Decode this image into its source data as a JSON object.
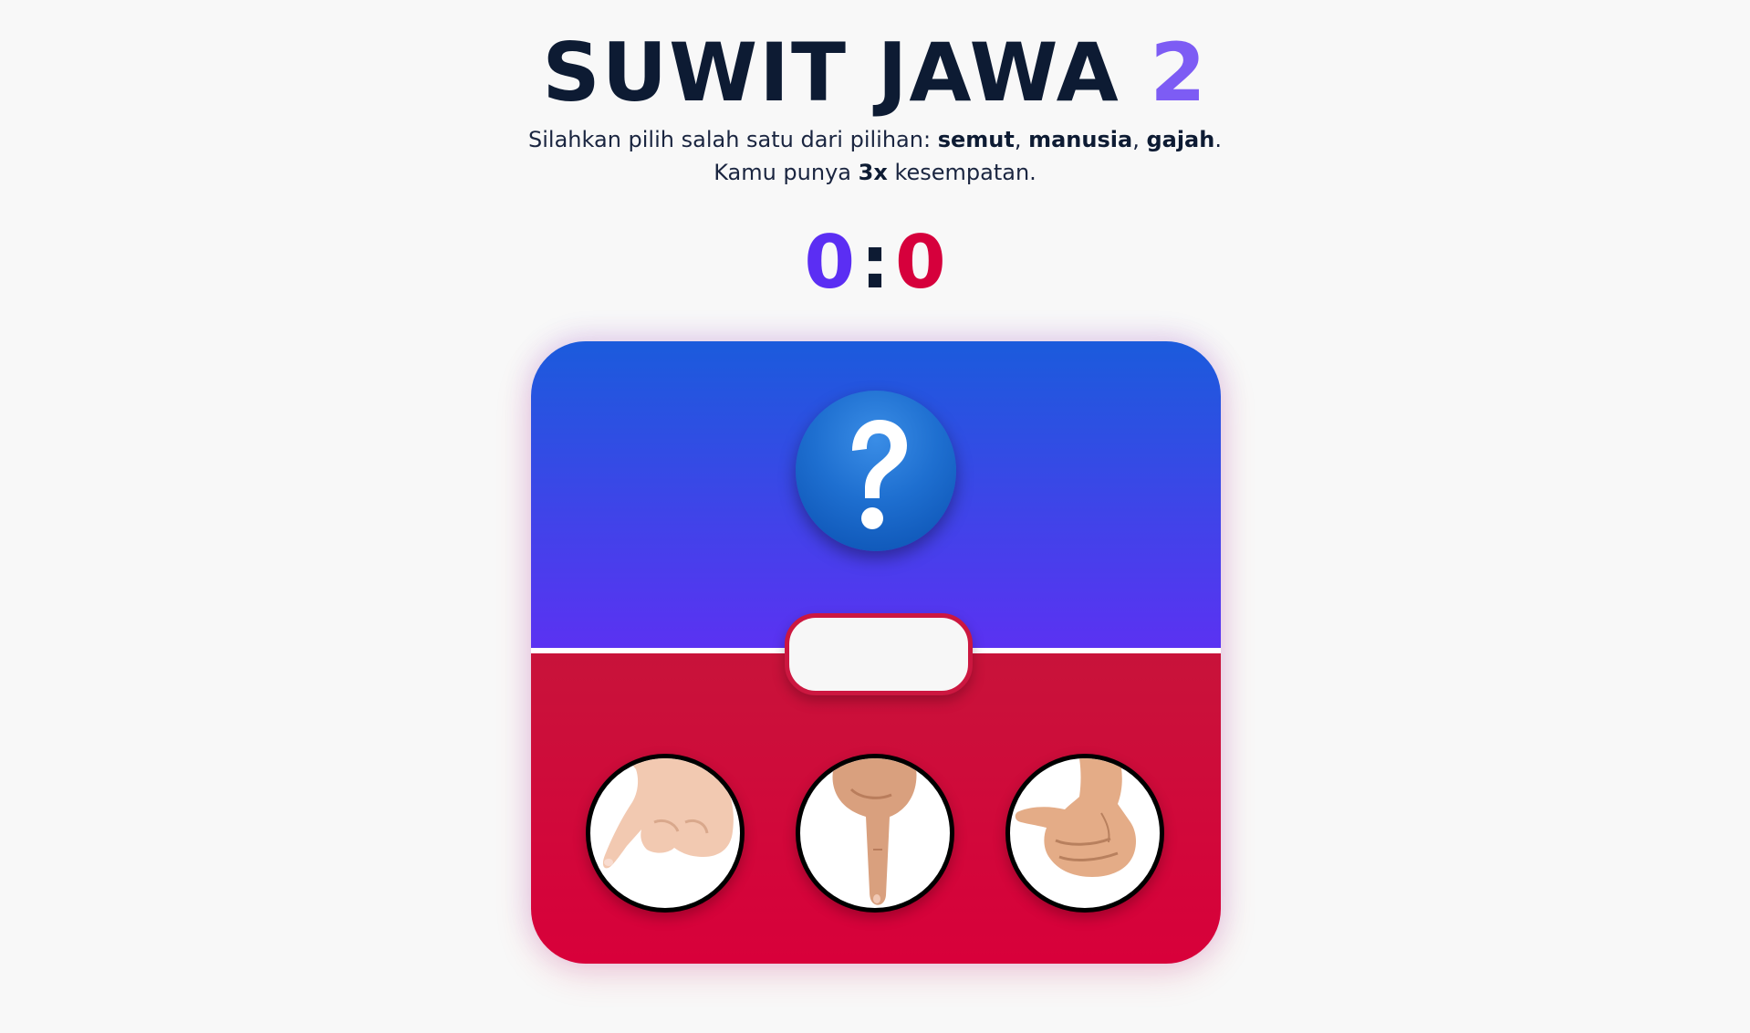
{
  "header": {
    "title_text": "SUWIT JAWA",
    "title_number": "2"
  },
  "instructions": {
    "line1_prefix": "Silahkan pilih salah satu dari pilihan: ",
    "choice1": "semut",
    "comma1": ", ",
    "choice2": "manusia",
    "comma2": ", ",
    "choice3": "gajah",
    "period": ".",
    "line2_prefix": "Kamu punya ",
    "chances": "3x",
    "line2_suffix": " kesempatan."
  },
  "score": {
    "player": "0",
    "separator": ":",
    "computer": "0"
  },
  "board": {
    "computer_choice_icon": "question-mark-icon",
    "result_text": "",
    "choices": [
      {
        "name": "semut",
        "icon": "pinky-finger-icon"
      },
      {
        "name": "manusia",
        "icon": "index-finger-icon"
      },
      {
        "name": "gajah",
        "icon": "thumb-icon"
      }
    ]
  },
  "colors": {
    "player": "#5b2ef3",
    "computer": "#d6003c",
    "title_accent": "#7d5cf4",
    "top_gradient_start": "#1b5bdc",
    "top_gradient_end": "#5b32f2",
    "bottom_gradient_start": "#c8133a",
    "bottom_gradient_end": "#d8003a"
  }
}
